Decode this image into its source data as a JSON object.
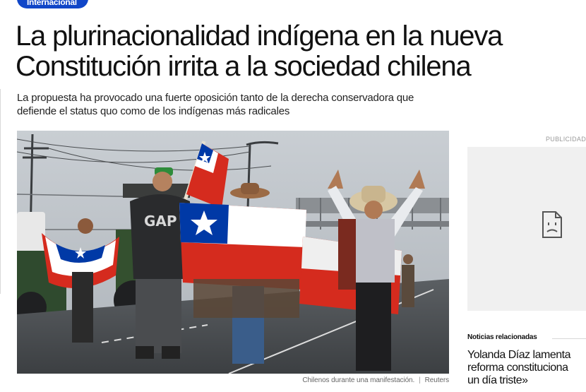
{
  "article": {
    "section": "Internacional",
    "headline": "La plurinacionalidad indígena en la nueva Constitución irrita a la sociedad chilena",
    "subheadline": "La propuesta ha provocado una fuerte oposición tanto de la derecha conservadora que defiende el status quo como de los indígenas más radicales",
    "image": {
      "caption": "Chilenos durante una manifestación.",
      "credit": "Reuters"
    }
  },
  "sidebar": {
    "ad_label": "PUBLICIDAD",
    "ad_icon": "broken-page-icon",
    "related": {
      "title": "Noticias relacionadas",
      "items": [
        {
          "text": "Yolanda Díaz lamenta\nreforma constituciona\nun día triste»"
        }
      ]
    }
  },
  "colors": {
    "badge_blue": "#1046c8",
    "flag_red": "#d52b1e",
    "flag_blue": "#0039a6"
  }
}
